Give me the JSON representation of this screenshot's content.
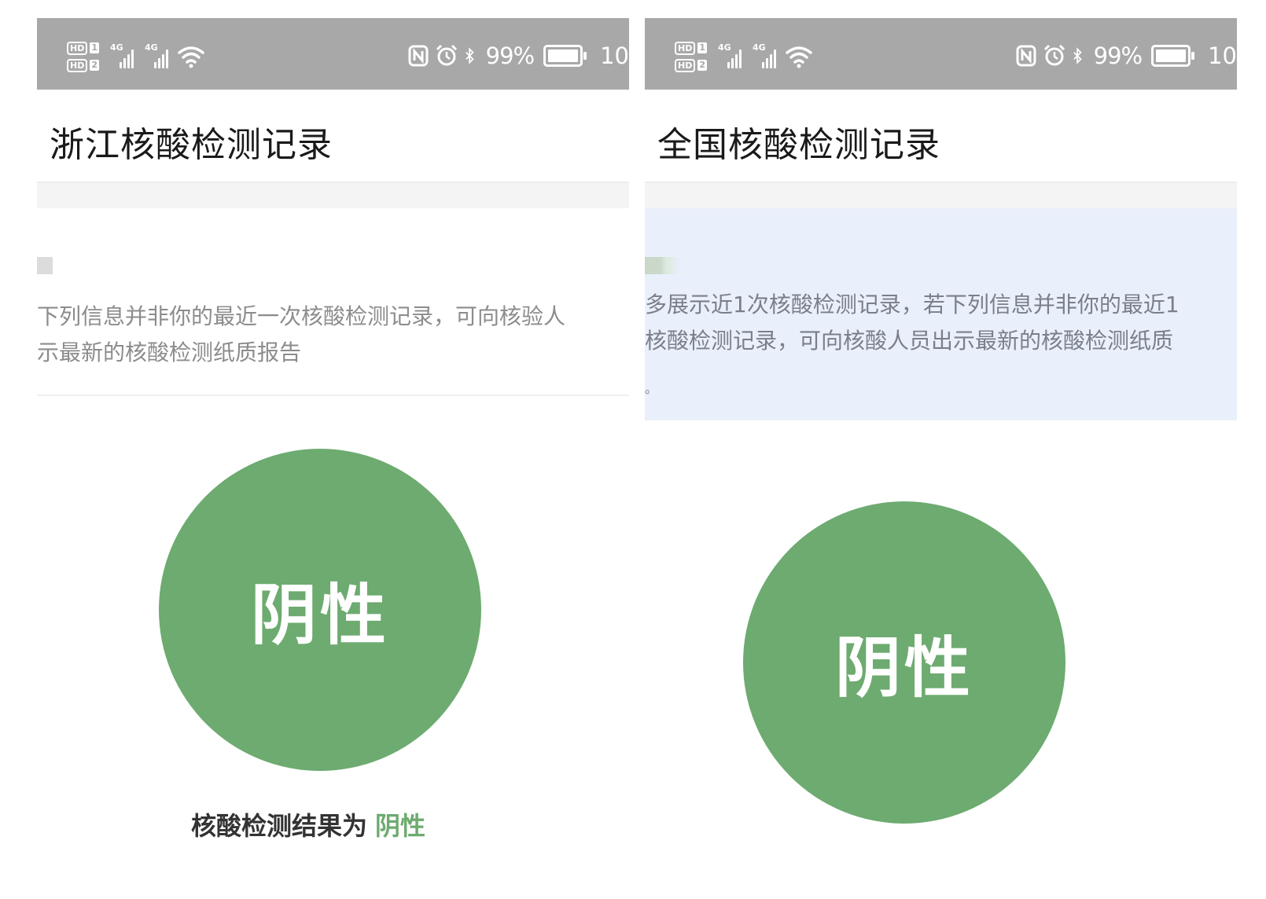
{
  "status_bar": {
    "sim1": "HD",
    "sim1_num": "1",
    "sim2": "HD",
    "sim2_num": "2",
    "net1": "4G",
    "net2": "4G",
    "battery_percent": "99%",
    "time": "10"
  },
  "left": {
    "title": "浙江核酸检测记录",
    "notice": "下列信息并非你的最近一次核酸检测记录，可向核验人\n示最新的核酸检测纸质报告",
    "result_circle_label": "阴性",
    "result_prefix": "核酸检测结果为",
    "result_value": "阴性"
  },
  "right": {
    "title": "全国核酸检测记录",
    "notice": "多展示近1次核酸检测记录，若下列信息并非你的最近1\n核酸检测记录，可向核酸人员出示最新的核酸检测纸质",
    "notice_end": "。",
    "result_circle_label": "阴性"
  },
  "colors": {
    "status_bar": "#a8a8a8",
    "result_green": "#6dab70",
    "notice_bg_right": "#e9f0fb"
  },
  "icons": [
    "nfc-icon",
    "alarm-icon",
    "bluetooth-icon",
    "battery-icon",
    "wifi-icon",
    "signal-icon"
  ]
}
